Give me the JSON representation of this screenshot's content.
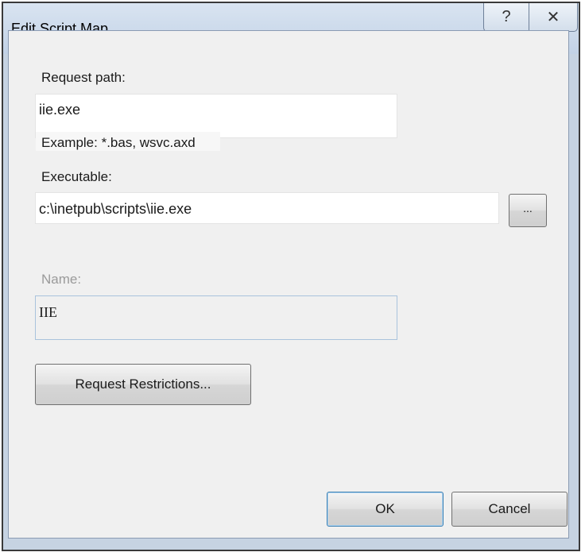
{
  "window": {
    "title": "Edit Script Map",
    "help_glyph": "?",
    "close_glyph": "✕"
  },
  "request_path": {
    "label": "Request path:",
    "value": "iie.exe",
    "example": "Example: *.bas, wsvc.axd"
  },
  "executable": {
    "label": "Executable:",
    "value": "c:\\inetpub\\scripts\\iie.exe",
    "browse_label": "..."
  },
  "name": {
    "label": "Name:",
    "value": "IIE"
  },
  "buttons": {
    "request_restrictions": "Request Restrictions...",
    "ok": "OK",
    "cancel": "Cancel"
  }
}
